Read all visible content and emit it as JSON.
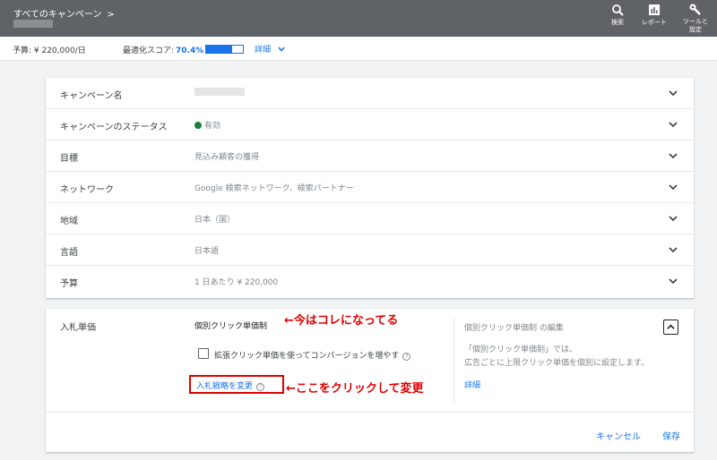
{
  "header": {
    "breadcrumb": "すべてのキャンペーン",
    "breadcrumb_chevron": ">",
    "icons": [
      {
        "name": "search-icon",
        "label": "検索"
      },
      {
        "name": "reports-icon",
        "label": "レポート"
      },
      {
        "name": "tools-icon",
        "label": "ツールと設定"
      }
    ]
  },
  "infobar": {
    "budget": "予算: ¥ 220,000/日",
    "score_label": "最適化スコア:",
    "score_value": "70.4%",
    "score_fraction": 0.704,
    "details_label": "詳細"
  },
  "settings": [
    {
      "label": "キャンペーン名",
      "value": ""
    },
    {
      "label": "キャンペーンのステータス",
      "value": "有効"
    },
    {
      "label": "目標",
      "value": "見込み顧客の獲得"
    },
    {
      "label": "ネットワーク",
      "value": "Google 検索ネットワーク、検索パートナー"
    },
    {
      "label": "地域",
      "value": "日本（国）"
    },
    {
      "label": "言語",
      "value": "日本語"
    },
    {
      "label": "予算",
      "value": "1 日あたり ¥ 220,000"
    }
  ],
  "bidding": {
    "label": "入札単価",
    "strategy": "個別クリック単価制",
    "annotation_current": "←今はコレになってる",
    "checkbox_label": "拡張クリック単価を使ってコンバージョンを増やす",
    "change_link": "入札戦略を変更",
    "annotation_change": "←ここをクリックして変更",
    "side_title": "個別クリック単価制 の編集",
    "side_desc_line1": "「個別クリック単価制」では、",
    "side_desc_line2": "広告ごとに上限クリック単価を個別に設定します。",
    "side_more": "詳細",
    "cancel": "キャンセル",
    "save": "保存"
  },
  "colors": {
    "header_bg": "#5f6368",
    "accent": "#1a73e8",
    "status_green": "#188038",
    "annotation_red": "#e00000"
  }
}
